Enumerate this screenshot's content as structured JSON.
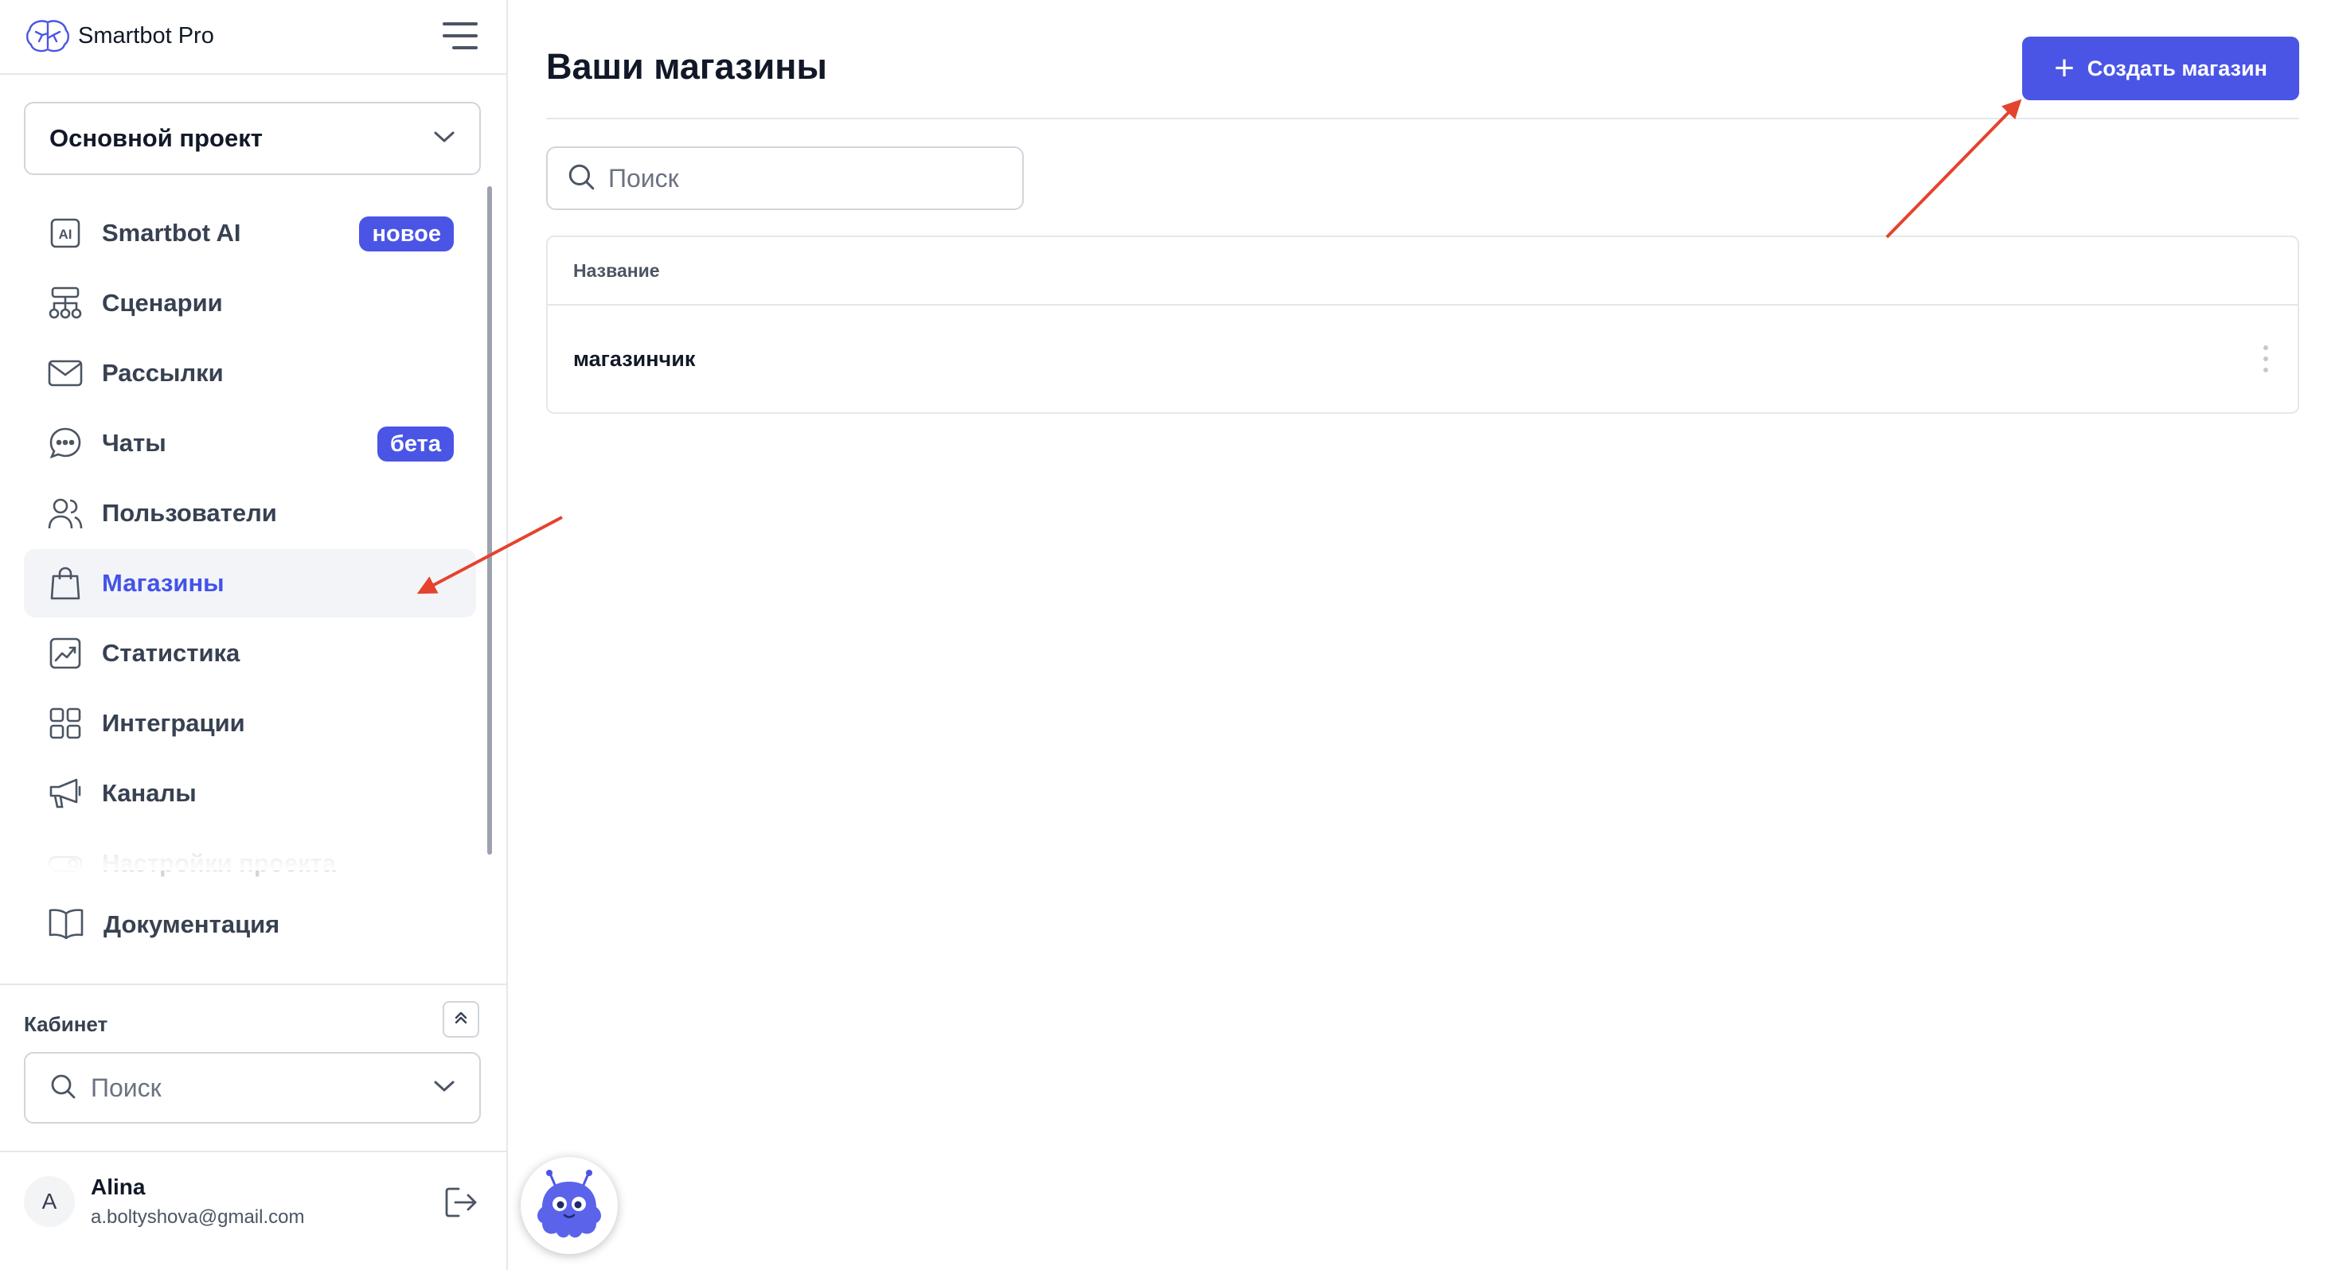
{
  "sidebar": {
    "brand": "Smartbot Pro",
    "project": "Основной проект",
    "nav": [
      {
        "label": "Smartbot AI",
        "icon": "ai-icon",
        "badge": "новое"
      },
      {
        "label": "Сценарии",
        "icon": "scenarios-icon"
      },
      {
        "label": "Рассылки",
        "icon": "mail-icon"
      },
      {
        "label": "Чаты",
        "icon": "chat-icon",
        "badge": "бета"
      },
      {
        "label": "Пользователи",
        "icon": "users-icon"
      },
      {
        "label": "Магазины",
        "icon": "shopping-bag-icon",
        "active": true
      },
      {
        "label": "Статистика",
        "icon": "chart-icon"
      },
      {
        "label": "Интеграции",
        "icon": "grid-icon"
      },
      {
        "label": "Каналы",
        "icon": "megaphone-icon"
      },
      {
        "label": "Настройки проекта",
        "icon": "toggle-icon"
      }
    ],
    "docs": "Документация",
    "cabinet": {
      "label": "Кабинет",
      "placeholder": "Поиск"
    },
    "user": {
      "initial": "A",
      "name": "Alina",
      "email": "a.boltyshova@gmail.com"
    }
  },
  "main": {
    "title": "Ваши магазины",
    "create_button": "Создать магазин",
    "search_placeholder": "Поиск",
    "table": {
      "header": "Название",
      "rows": [
        "магазинчик"
      ]
    }
  },
  "colors": {
    "accent": "#4a55e6",
    "annotation_arrow": "#e5432d"
  }
}
